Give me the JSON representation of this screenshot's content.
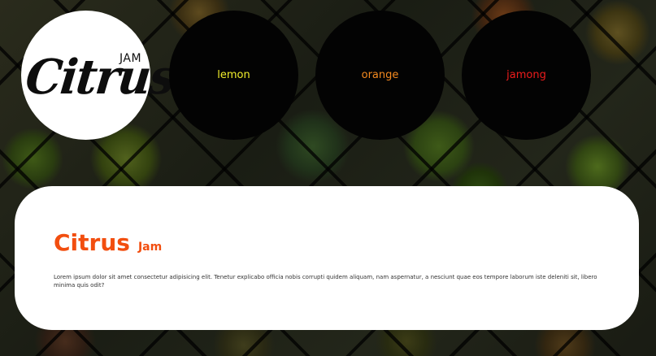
{
  "logo": {
    "word": "Citrus",
    "tag": "JAM"
  },
  "nav": [
    {
      "label": "lemon",
      "color": "#f1ee2c"
    },
    {
      "label": "orange",
      "color": "#f58a1f"
    },
    {
      "label": "jamong",
      "color": "#ee1c1c"
    }
  ],
  "content": {
    "title": "Citrus",
    "subtitle": "Jam",
    "title_color": "#f24e0f",
    "body": "Lorem ipsum dolor sit amet consectetur adipisicing elit. Tenetur explicabo officia nobis corrupti quidem aliquam, nam aspernatur, a nesciunt quae eos tempore laborum iste deleniti sit, libero minima quis odit?"
  }
}
